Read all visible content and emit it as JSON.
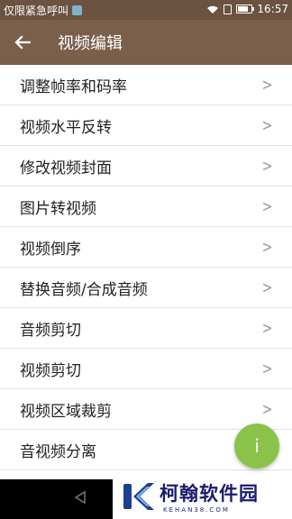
{
  "status_bar": {
    "carrier": "仅限紧急呼叫",
    "time": "16:57",
    "icons": [
      "wifi-icon",
      "sim-icon",
      "battery-icon"
    ]
  },
  "app_bar": {
    "title": "视频编辑",
    "back_icon": "arrow-left-icon"
  },
  "menu": {
    "items": [
      {
        "label": "调整帧率和码率"
      },
      {
        "label": "视频水平反转"
      },
      {
        "label": "修改视频封面"
      },
      {
        "label": "图片转视频"
      },
      {
        "label": "视频倒序"
      },
      {
        "label": "替换音频/合成音频"
      },
      {
        "label": "音频剪切"
      },
      {
        "label": "视频剪切"
      },
      {
        "label": "视频区域裁剪"
      },
      {
        "label": "音视频分离"
      }
    ]
  },
  "fab": {
    "label": "i"
  },
  "watermark": {
    "title": "柯翰软件园",
    "url": "KEHAN38.COM"
  },
  "colors": {
    "status_bar": "#6b5241",
    "app_bar": "#7a5f4b",
    "fab": "#8bc34a"
  }
}
